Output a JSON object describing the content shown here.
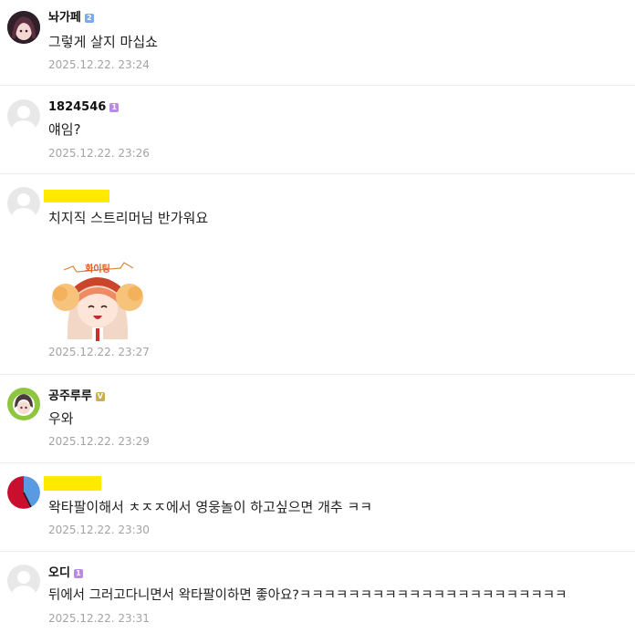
{
  "comments": [
    {
      "nick": "놔가페",
      "badge": "2",
      "badge_color": "#7ba8ef",
      "text": "그렇게 살지 마십쇼",
      "date": "2025.12.22.  23:24",
      "avatar": "anime-girl-avatar"
    },
    {
      "nick": "1824546",
      "badge": "1",
      "badge_color": "#b78be3",
      "text": "얘임?",
      "date": "2025.12.22.  23:26",
      "avatar": "default-avatar"
    },
    {
      "nick": "",
      "redacted": true,
      "text": "치지직 스트리머님 반가워요",
      "sticker": "화이팅",
      "date": "2025.12.22.  23:27",
      "avatar": "default-avatar"
    },
    {
      "nick": "공주루루",
      "badge": "V",
      "badge_color": "#c8b04a",
      "text": "우와",
      "date": "2025.12.22.  23:29",
      "avatar": "green-anime-avatar"
    },
    {
      "nick": "",
      "redacted": true,
      "text": "왁타팔이해서 ㅊㅈㅈ에서 영웅놀이 하고싶으면 개추 ㅋㅋ",
      "date": "2025.12.22.  23:30",
      "avatar": "red-blue-avatar"
    },
    {
      "nick": "오디",
      "badge": "1",
      "badge_color": "#b78be3",
      "text": "뒤에서 그러고다니면서 왁타팔이하면 좋아요?ㅋㅋㅋㅋㅋㅋㅋㅋㅋㅋㅋㅋㅋㅋㅋㅋㅋㅋㅋㅋㅋㅋ",
      "date": "2025.12.22.  23:31",
      "avatar": "default-avatar"
    }
  ]
}
